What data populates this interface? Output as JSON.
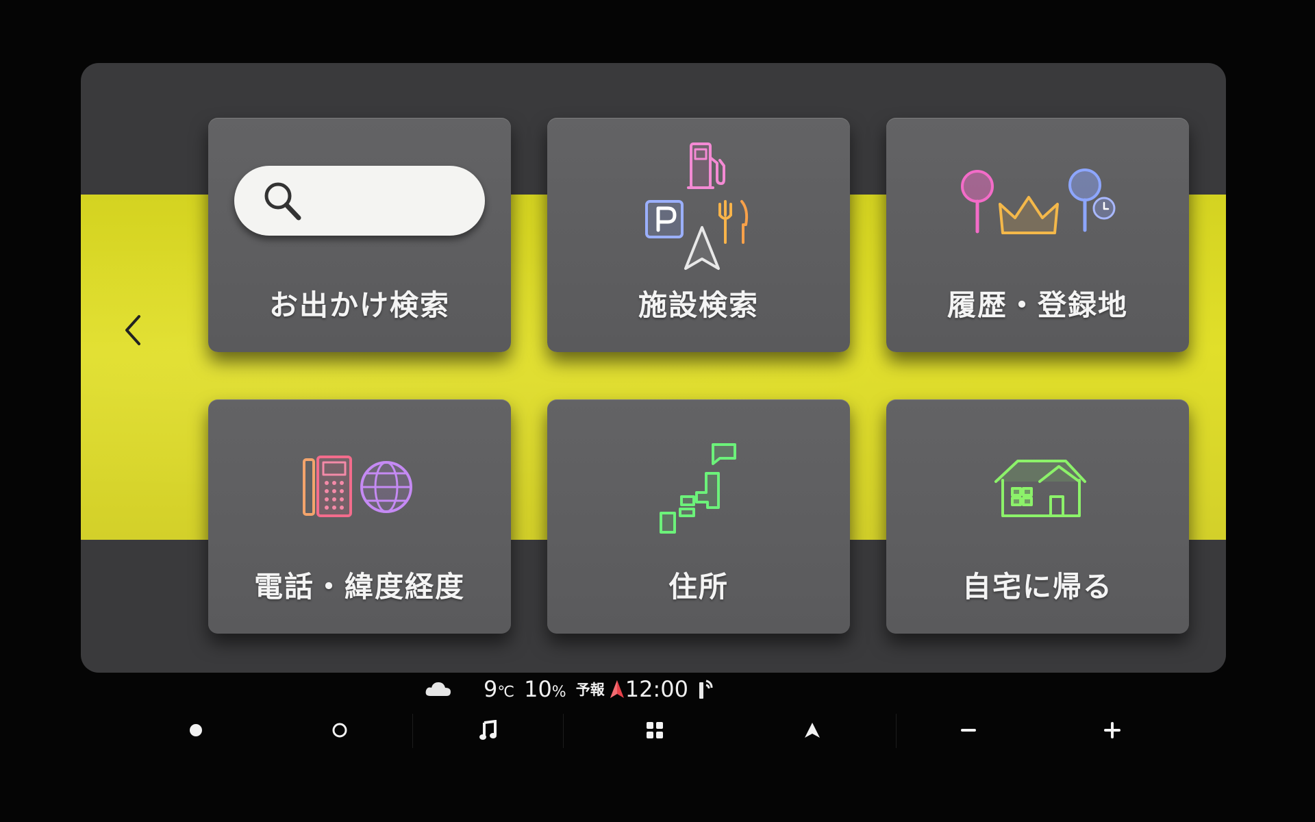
{
  "menu": {
    "tiles": [
      {
        "label": "お出かけ検索",
        "icon": "search-bar-icon"
      },
      {
        "label": "施設検索",
        "icon": "facility-poi-icon"
      },
      {
        "label": "履歴・登録地",
        "icon": "history-favorites-icon"
      },
      {
        "label": "電話・緯度経度",
        "icon": "phone-globe-icon"
      },
      {
        "label": "住所",
        "icon": "japan-map-icon"
      },
      {
        "label": "自宅に帰る",
        "icon": "home-icon"
      }
    ],
    "back_icon": "chevron-left-icon"
  },
  "status": {
    "weather_icon": "cloud-icon",
    "temperature": "9",
    "temperature_unit": "℃",
    "precipitation": "10",
    "precipitation_unit": "%",
    "forecast_label": "予報",
    "time": "12:00",
    "signal_icon": "signal-icon"
  },
  "nav": {
    "buttons": [
      {
        "icon": "dot-filled-icon"
      },
      {
        "icon": "dot-outline-icon"
      },
      {
        "icon": "music-note-icon"
      },
      {
        "icon": "apps-grid-icon"
      },
      {
        "icon": "navigation-arrow-icon"
      },
      {
        "icon": "minus-icon"
      },
      {
        "icon": "plus-icon"
      }
    ]
  },
  "colors": {
    "band": "#e1df2a",
    "panel": "#3a3a3c",
    "tile": "#5f5f61",
    "accent_green": "#6cf27a",
    "accent_pink": "#f36cc8",
    "accent_blue": "#8da6ff"
  }
}
